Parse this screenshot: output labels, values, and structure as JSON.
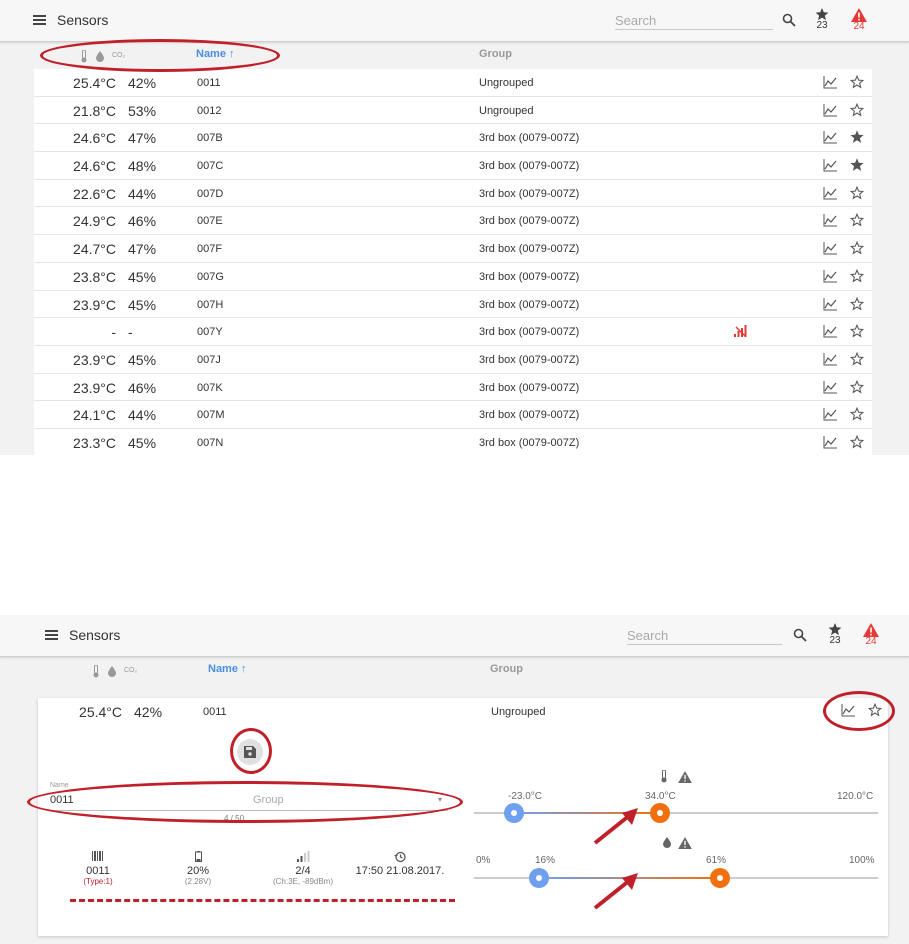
{
  "app": {
    "title": "Sensors",
    "search_placeholder": "Search",
    "favorites_count": "23",
    "alerts_count": "24"
  },
  "colors": {
    "accent": "#4a8fe2",
    "alert": "#e53935",
    "annotation": "#c0202a",
    "low_thumb": "#6fa0f0",
    "high_thumb": "#f07010"
  },
  "header": {
    "co2": "CO₂",
    "name": "Name",
    "group": "Group"
  },
  "rows": [
    {
      "temp": "25.4°C",
      "hum": "42%",
      "name": "0011",
      "group": "Ungrouped",
      "starred": false,
      "alert": false
    },
    {
      "temp": "21.8°C",
      "hum": "53%",
      "name": "0012",
      "group": "Ungrouped",
      "starred": false,
      "alert": false
    },
    {
      "temp": "24.6°C",
      "hum": "47%",
      "name": "007B",
      "group": "3rd box (0079-007Z)",
      "starred": true,
      "alert": false
    },
    {
      "temp": "24.6°C",
      "hum": "48%",
      "name": "007C",
      "group": "3rd box (0079-007Z)",
      "starred": true,
      "alert": false
    },
    {
      "temp": "22.6°C",
      "hum": "44%",
      "name": "007D",
      "group": "3rd box (0079-007Z)",
      "starred": false,
      "alert": false
    },
    {
      "temp": "24.9°C",
      "hum": "46%",
      "name": "007E",
      "group": "3rd box (0079-007Z)",
      "starred": false,
      "alert": false
    },
    {
      "temp": "24.7°C",
      "hum": "47%",
      "name": "007F",
      "group": "3rd box (0079-007Z)",
      "starred": false,
      "alert": false
    },
    {
      "temp": "23.8°C",
      "hum": "45%",
      "name": "007G",
      "group": "3rd box (0079-007Z)",
      "starred": false,
      "alert": false
    },
    {
      "temp": "23.9°C",
      "hum": "45%",
      "name": "007H",
      "group": "3rd box (0079-007Z)",
      "starred": false,
      "alert": false
    },
    {
      "temp": "-",
      "hum": "-",
      "name": "007Y",
      "group": "3rd box (0079-007Z)",
      "starred": false,
      "alert": true
    },
    {
      "temp": "23.9°C",
      "hum": "45%",
      "name": "007J",
      "group": "3rd box (0079-007Z)",
      "starred": false,
      "alert": false
    },
    {
      "temp": "23.9°C",
      "hum": "46%",
      "name": "007K",
      "group": "3rd box (0079-007Z)",
      "starred": false,
      "alert": false
    },
    {
      "temp": "24.1°C",
      "hum": "44%",
      "name": "007M",
      "group": "3rd box (0079-007Z)",
      "starred": false,
      "alert": false
    },
    {
      "temp": "23.3°C",
      "hum": "45%",
      "name": "007N",
      "group": "3rd box (0079-007Z)",
      "starred": false,
      "alert": false
    }
  ],
  "detail": {
    "temp": "25.4°C",
    "hum": "42%",
    "name": "0011",
    "group": "Ungrouped",
    "name_field_label": "Name",
    "name_field_value": "0011",
    "group_placeholder": "Group",
    "char_counter": "4 / 50",
    "stats": [
      {
        "icon": "barcode-icon",
        "value": "0011",
        "sub": "(Type:1)"
      },
      {
        "icon": "battery-icon",
        "value": "20%",
        "sub": "(2.28V)"
      },
      {
        "icon": "signal-icon",
        "value": "2/4",
        "sub": "(Ch:3E, -89dBm)"
      },
      {
        "icon": "history-icon",
        "value": "17:50 21.08.2017.",
        "sub": ""
      }
    ],
    "temp_slider": {
      "min_label": "-23.0°C",
      "mid_label": "34.0°C",
      "max_label": "120.0°C",
      "low": 0.1,
      "high": 0.46
    },
    "hum_slider": {
      "min_label": "0%",
      "low_label": "16%",
      "high_label": "61%",
      "max_label": "100%",
      "low": 0.16,
      "high": 0.61
    }
  }
}
